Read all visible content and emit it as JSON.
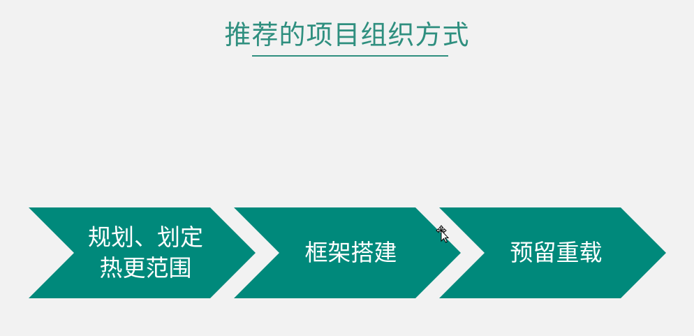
{
  "title": "推荐的项目组织方式",
  "colors": {
    "accent": "#00897b",
    "title": "#2f8f7f",
    "background": "#f2f2f2",
    "label": "#ffffff"
  },
  "steps": [
    {
      "line1": "规划、划定",
      "line2": "热更范围"
    },
    {
      "line1": "框架搭建",
      "line2": ""
    },
    {
      "line1": "预留重载",
      "line2": ""
    }
  ],
  "icons": {
    "cursor": "move-cursor-icon"
  }
}
